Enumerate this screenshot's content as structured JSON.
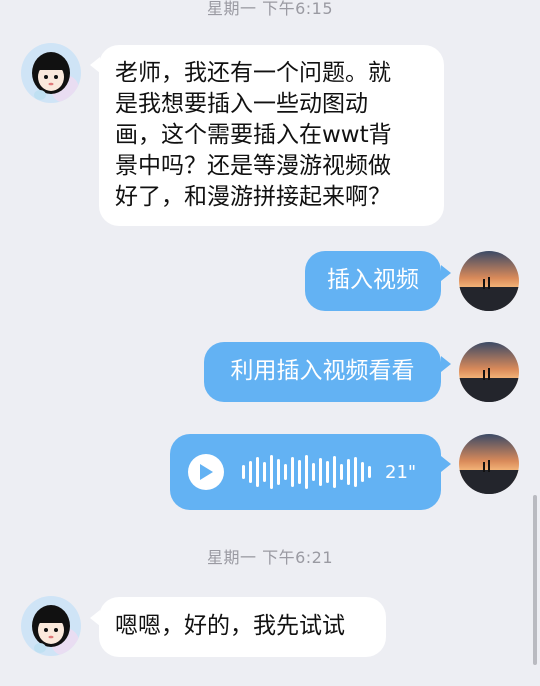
{
  "timestamps": [
    "星期一 下午6:15",
    "星期一 下午6:21"
  ],
  "messages": [
    {
      "from": "teacher-contact",
      "text": "老师，我还有一个问题。就是我想要插入一些动图动画，这个需要插入在wwt背景中吗？还是等漫游视频做好了，和漫游拼接起来啊？",
      "lines": [
        "老师，我还有一个问题。就",
        "是我想要插入一些动图动",
        "画，这个需要插入在wwt背",
        "景中吗？还是等漫游视频做",
        "好了，和漫游拼接起来啊？"
      ]
    },
    {
      "from": "me",
      "text": "插入视频"
    },
    {
      "from": "me",
      "text": "利用插入视频看看"
    },
    {
      "from": "me",
      "type": "voice",
      "duration": "21\"",
      "icon": "play-icon"
    },
    {
      "from": "teacher-contact",
      "text": "嗯嗯，好的，我先试试"
    }
  ],
  "colors": {
    "outgoing_bubble": "#63b2f3",
    "incoming_bubble": "#ffffff",
    "background": "#edeef3"
  }
}
